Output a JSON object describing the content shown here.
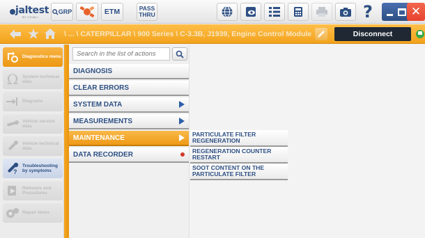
{
  "logo": {
    "wordmark": "jaltest",
    "tagline": "BY COJALI"
  },
  "toolbar": {
    "grp_label": "GRP",
    "etm_label": "ETM",
    "passthru_label": "PASS THRU"
  },
  "path": {
    "text": "\\ ... \\ CATERPILLAR \\ 900 Series \\ C-3.3B, J1939, Engine Control Module",
    "disconnect_label": "Disconnect"
  },
  "sidebar": {
    "items": [
      {
        "label": "Diagnostics menu"
      },
      {
        "label": "System technical data"
      },
      {
        "label": "Diagrams"
      },
      {
        "label": "Vehicle service data"
      },
      {
        "label": "Vehicle technical data"
      },
      {
        "label": "Troubleshooting by symptoms"
      },
      {
        "label": "Releases and Procedures"
      },
      {
        "label": "Repair times"
      }
    ]
  },
  "search": {
    "placeholder": "Search in the list of actions"
  },
  "actions": [
    {
      "label": "DIAGNOSIS"
    },
    {
      "label": "CLEAR ERRORS"
    },
    {
      "label": "SYSTEM DATA"
    },
    {
      "label": "MEASUREMENTS"
    },
    {
      "label": "MAINTENANCE"
    },
    {
      "label": "DATA RECORDER"
    }
  ],
  "submenu": [
    {
      "line1": "PARTICULATE FILTER",
      "line2": "REGENERATION"
    },
    {
      "line1": "REGENERATION COUNTER",
      "line2": "RESTART"
    },
    {
      "line1": "SOOT CONTENT ON THE",
      "line2": "PARTICULATE FILTER"
    }
  ],
  "colors": {
    "accent": "#f2a21b",
    "brand": "#2d4f83",
    "close": "#e8432e"
  }
}
